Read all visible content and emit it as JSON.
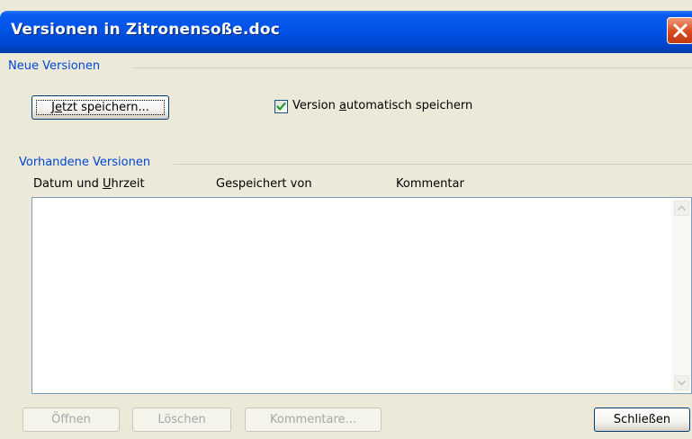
{
  "window": {
    "title": "Versionen in Zitronensoße.doc"
  },
  "new_versions": {
    "group_label": "Neue Versionen",
    "save_now_pre": "J",
    "save_now_acc": "e",
    "save_now_post": "tzt speichern...",
    "autosave_pre": "Version ",
    "autosave_acc": "a",
    "autosave_post": "utomatisch speichern",
    "autosave_checked": true
  },
  "existing_versions": {
    "group_label": "Vorhandene Versionen",
    "columns": {
      "date_pre": "Datum und ",
      "date_acc": "U",
      "date_post": "hrzeit",
      "saved_by": "Gespeichert von",
      "comment": "Kommentar"
    },
    "rows": []
  },
  "buttons": {
    "open": "Öffnen",
    "delete": "Löschen",
    "comments": "Kommentare...",
    "close": "Schließen"
  },
  "icons": {
    "close": "close-x-icon",
    "check": "checkmark-icon",
    "scroll_up": "scroll-up-arrow-icon",
    "scroll_down": "scroll-down-arrow-icon"
  },
  "colors": {
    "titlebar": "#0053e6",
    "group_label": "#0046d5",
    "dialog_bg": "#ece9d8",
    "checkmark": "#21a121",
    "close_button": "#d8491e"
  }
}
